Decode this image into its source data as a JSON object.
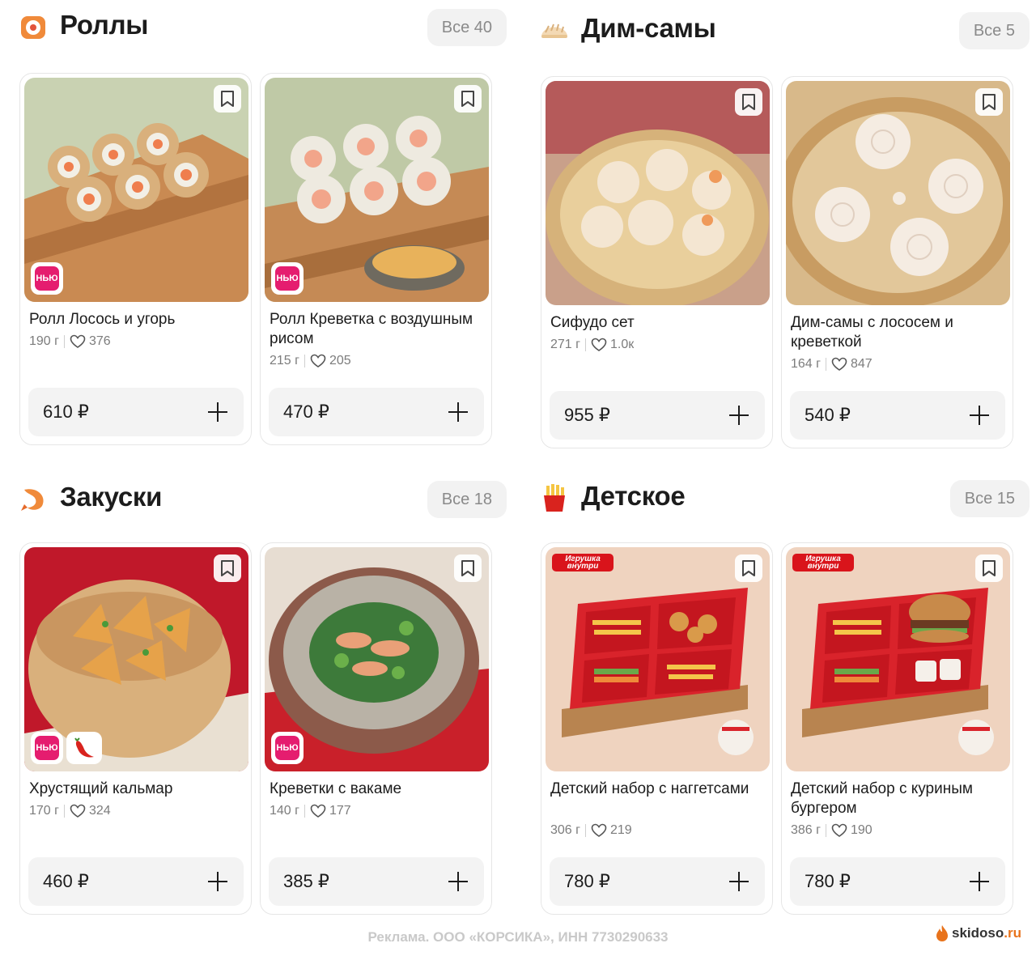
{
  "sections": [
    {
      "title": "Роллы",
      "all_label": "Все 40",
      "icon": "roll-icon",
      "items": [
        {
          "name": "Ролл Лосось и угорь",
          "weight": "190 г",
          "likes": "376",
          "price": "610 ₽",
          "badge": "НЬЮ"
        },
        {
          "name": "Ролл Креветка с воздушным рисом",
          "weight": "215 г",
          "likes": "205",
          "price": "470 ₽",
          "badge": "НЬЮ"
        }
      ]
    },
    {
      "title": "Дим-самы",
      "all_label": "Все 5",
      "icon": "dumpling-icon",
      "items": [
        {
          "name": "Сифудо сет",
          "weight": "271 г",
          "likes": "1.0к",
          "price": "955 ₽"
        },
        {
          "name": "Дим-самы с лососем и креветкой",
          "weight": "164 г",
          "likes": "847",
          "price": "540 ₽"
        }
      ]
    },
    {
      "title": "Закуски",
      "all_label": "Все 18",
      "icon": "shrimp-icon",
      "items": [
        {
          "name": "Хрустящий кальмар",
          "weight": "170 г",
          "likes": "324",
          "price": "460 ₽",
          "badge": "НЬЮ",
          "spicy": true
        },
        {
          "name": "Креветки с вакаме",
          "weight": "140 г",
          "likes": "177",
          "price": "385 ₽",
          "badge": "НЬЮ"
        }
      ]
    },
    {
      "title": "Детское",
      "all_label": "Все 15",
      "icon": "fries-icon",
      "items": [
        {
          "name": "Детский набор с наггетсами",
          "weight": "306 г",
          "likes": "219",
          "price": "780 ₽",
          "toy_badge": "Игрушка внутри"
        },
        {
          "name": "Детский набор с куриным бургером",
          "weight": "386 г",
          "likes": "190",
          "price": "780 ₽",
          "toy_badge": "Игрушка внутри"
        }
      ]
    }
  ],
  "footer": {
    "ad_text": "Реклама. ООО «КОРСИКА», ИНН 7730290633",
    "watermark_main": "skidoso",
    "watermark_tld": ".ru"
  },
  "colors": {
    "badge_new": "#e51d6f",
    "toy_badge": "#d9141b",
    "price_bar": "#f3f3f3"
  }
}
